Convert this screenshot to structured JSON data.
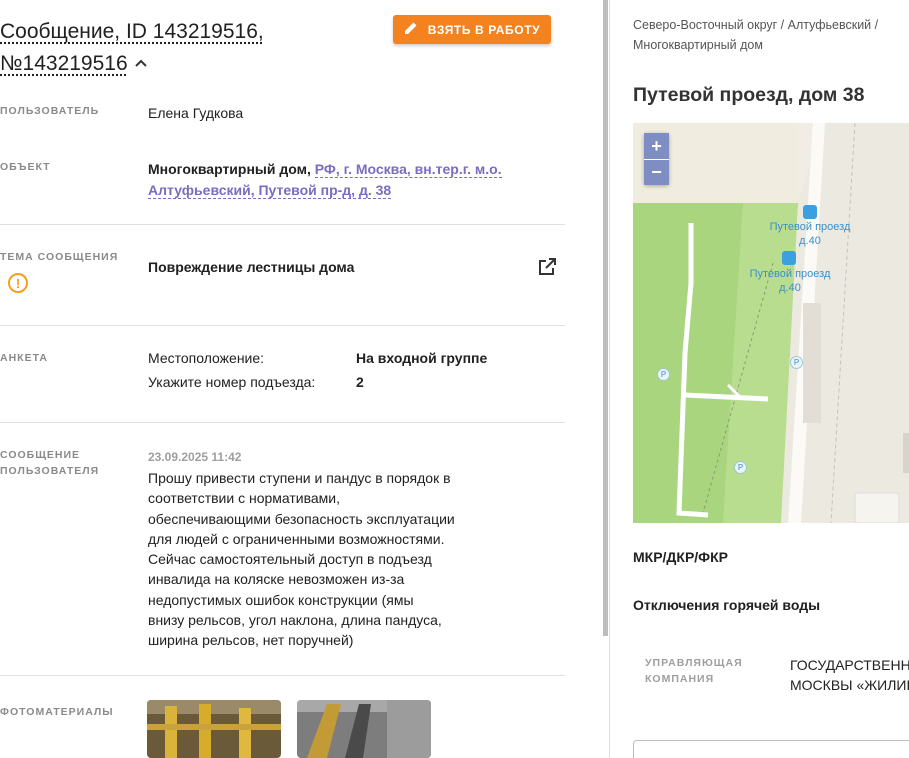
{
  "header": {
    "title_line1": "Сообщение, ID 143219516,",
    "title_line2": "№143219516",
    "take_button": "ВЗЯТЬ В РАБОТУ",
    "collapse_icon": "chevron-up-icon"
  },
  "user": {
    "label": "ПОЛЬЗОВАТЕЛЬ",
    "value": "Елена Гудкова"
  },
  "object": {
    "label": "ОБЪЕКТ",
    "type": "Многоквартирный дом,",
    "address_line1": "РФ, г. Москва, вн.тер.г. м.о.",
    "address_line2": "Алтуфьевский, Путевой пр-д, д. 38"
  },
  "topic": {
    "label": "ТЕМА СООБЩЕНИЯ",
    "value": "Повреждение лестницы дома",
    "warn_icon": "warning-icon",
    "open_icon": "external-link-icon",
    "warning_color": "#f4a01c"
  },
  "survey": {
    "label": "АНКЕТА",
    "items": [
      {
        "q": "Местоположение:",
        "a": "На входной группе"
      },
      {
        "q": "Укажите номер подъезда:",
        "a": "2"
      }
    ]
  },
  "message": {
    "label_line1": "СООБЩЕНИЕ",
    "label_line2": "ПОЛЬЗОВАТЕЛЯ",
    "date": "23.09.2025 11:42",
    "lines": [
      "Прошу привести ступени и пандус в порядок в",
      "соответствии с нормативами,",
      "обеспечивающими безопасность эксплуатации",
      "для людей с ограниченными возможностями.",
      "Сейчас самостоятельный доступ в подъезд",
      "инвалида на коляске невозможен из-за",
      "недопустимых ошибок конструкции (ямы",
      "внизу рельсов, угол наклона, длина пандуса,",
      "ширина рельсов, нет поручней)"
    ]
  },
  "photos": {
    "label": "ФОТОМАТЕРИАЛЫ"
  },
  "right": {
    "breadcrumb_line1": "Северо-Восточный округ / Алтуфьевский /",
    "breadcrumb_line2": "Многоквартирный дом",
    "address": "Путевой проезд, дом 38",
    "map": {
      "zoom_in": "+",
      "zoom_out": "−",
      "stop1_name": "Путевой проезд",
      "stop1_num": "д.40",
      "stop2_name": "Путевой проезд",
      "stop2_num": "д.40",
      "parking": "P"
    },
    "section1": "МКР/ДКР/ФКР",
    "section2": "Отключения горячей воды",
    "mc_label_line1": "УПРАВЛЯЮЩАЯ",
    "mc_label_line2": "КОМПАНИЯ",
    "mc_value_line1": "ГОСУДАРСТВЕННОЕ",
    "mc_value_line2": "МОСКВЫ «ЖИЛИЩН"
  },
  "colors": {
    "accent": "#f4831f",
    "link": "#7b6cc2",
    "zoom": "#7f8ec2"
  }
}
